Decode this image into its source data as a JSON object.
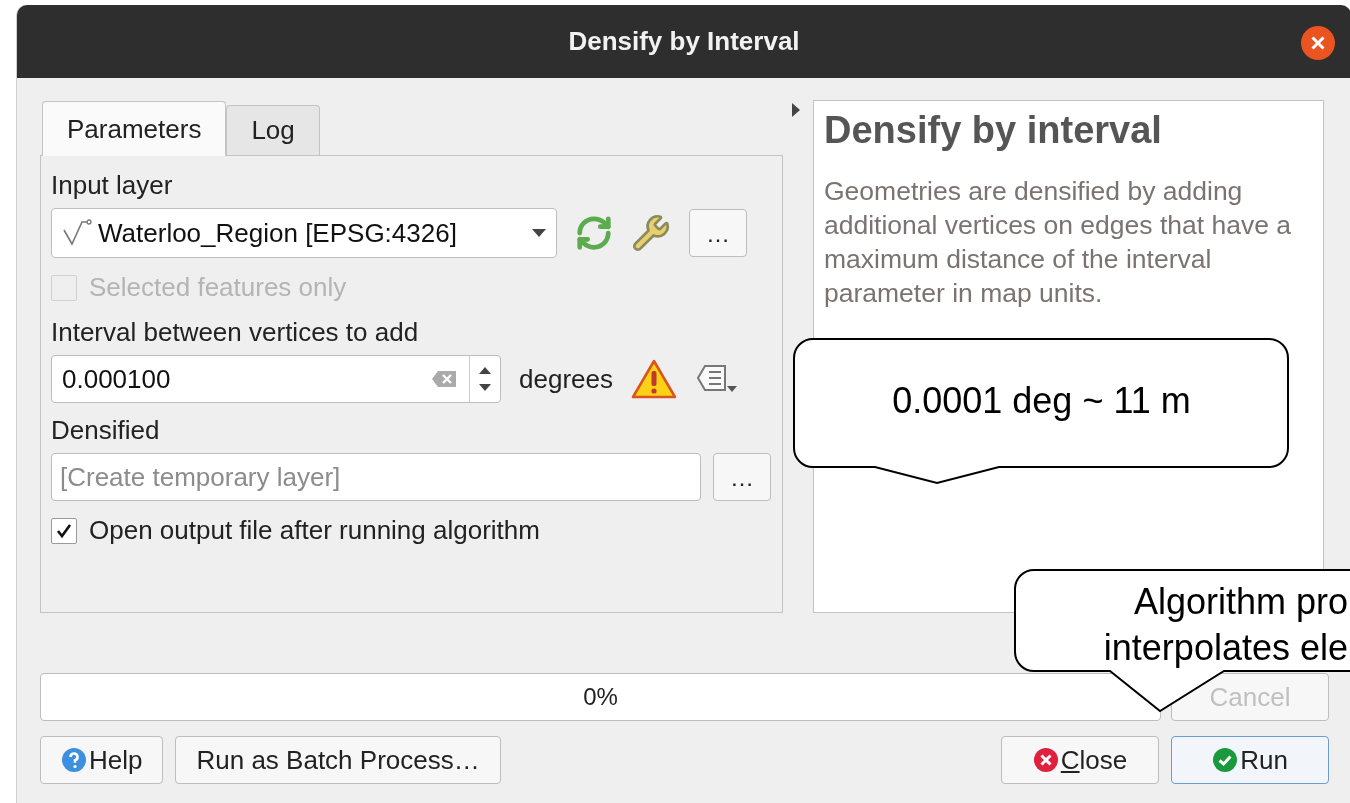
{
  "window": {
    "title": "Densify by Interval"
  },
  "tabs": [
    {
      "label": "Parameters",
      "selected": true
    },
    {
      "label": "Log",
      "selected": false
    }
  ],
  "input_layer": {
    "label": "Input layer",
    "value": "Waterloo_Region [EPSG:4326]",
    "browse": "…"
  },
  "selected_only": {
    "label": "Selected features only",
    "checked": false,
    "disabled": true
  },
  "interval": {
    "label": "Interval between vertices to add",
    "value": "0.000100",
    "unit": "degrees"
  },
  "output": {
    "label": "Densified",
    "placeholder": "[Create temporary layer]",
    "browse": "…"
  },
  "open_output": {
    "label": "Open output file after running algorithm",
    "checked": true,
    "disabled": false
  },
  "help": {
    "title": "Densify by interval",
    "text": "Geometries are densified by adding additional vertices on edges that have a maximum distance of the interval parameter in map units."
  },
  "progress": {
    "level": 0,
    "reading": "0%"
  },
  "cancel": {
    "label": "Cancel",
    "disabled": true
  },
  "buttons": [
    {
      "label": "Help",
      "kind": "help"
    },
    {
      "label": "Run as Batch Process…",
      "kind": "plain"
    },
    {
      "label": "Close",
      "kind": "close"
    },
    {
      "label": "Run",
      "kind": "run"
    }
  ],
  "callouts": [
    {
      "lines": [
        "0.0001 deg ~ 11 m"
      ]
    },
    {
      "lines": [
        "Algorithm pro",
        "interpolates ele"
      ]
    }
  ]
}
